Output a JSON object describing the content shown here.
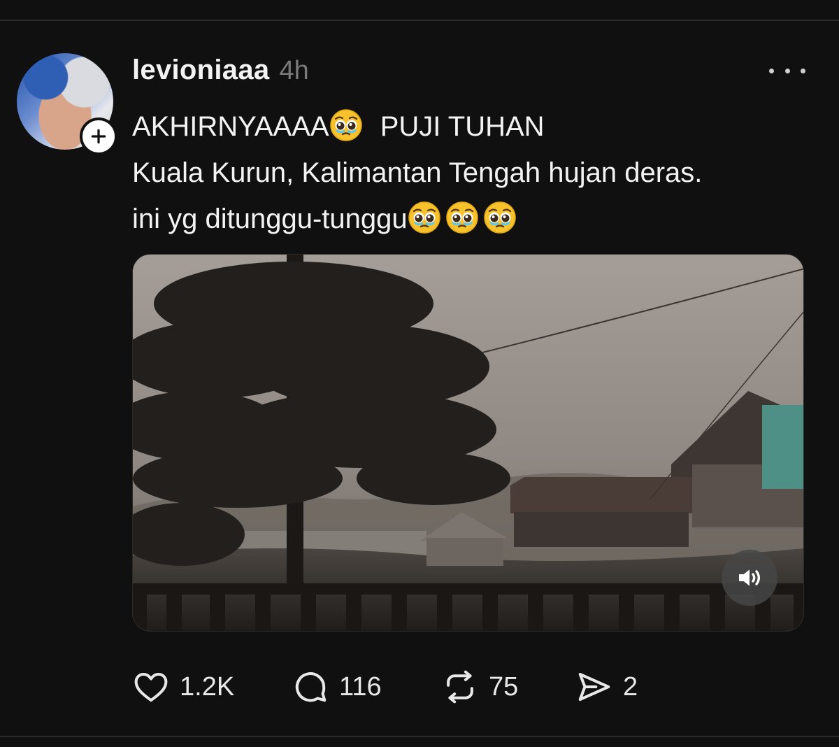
{
  "post": {
    "username": "levioniaaa",
    "time": "4h",
    "caption_lines": [
      "AKHIRNYAAAA",
      "PUJI TUHAN",
      "Kuala Kurun, Kalimantan Tengah hujan deras.",
      "ini yg ditunggu-tunggu"
    ],
    "emoji": "pleading-face-with-tears",
    "media": {
      "type": "video"
    },
    "stats": {
      "likes": "1.2K",
      "replies": "116",
      "reposts": "75",
      "shares": "2"
    }
  },
  "colors": {
    "background": "#101010",
    "text": "#f3f3f3",
    "muted": "#7a7a7a",
    "divider": "#2a2a2a"
  },
  "icons": {
    "more": "more-horizontal-icon",
    "follow": "plus-icon",
    "like": "heart-icon",
    "reply": "comment-icon",
    "repost": "repost-icon",
    "share": "send-icon",
    "sound": "volume-icon"
  }
}
